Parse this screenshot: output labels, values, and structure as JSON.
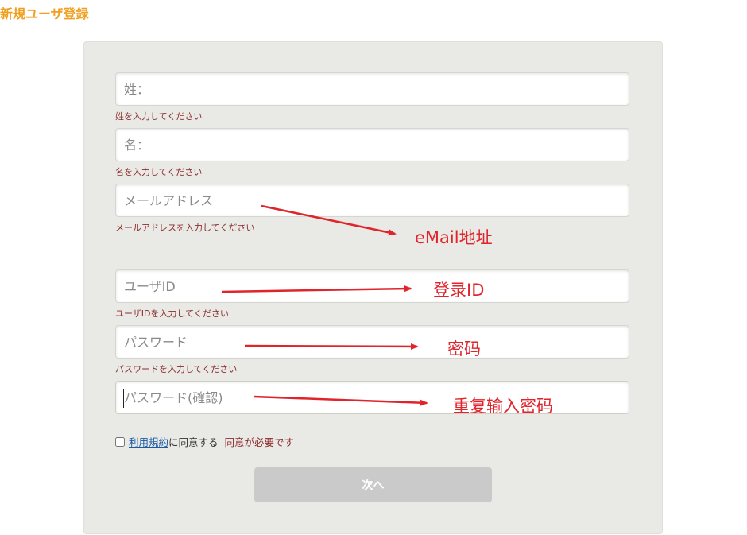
{
  "page": {
    "title": "新規ユーザ登録"
  },
  "form": {
    "last_name": {
      "placeholder": "姓：",
      "hint": "姓を入力してください"
    },
    "first_name": {
      "placeholder": "名：",
      "hint": "名を入力してください"
    },
    "email": {
      "placeholder": "メールアドレス",
      "hint": "メールアドレスを入力してください"
    },
    "user_id": {
      "placeholder": "ユーザID",
      "hint": "ユーザIDを入力してください"
    },
    "password": {
      "placeholder": "パスワード",
      "hint": "パスワードを入力してください"
    },
    "password_confirm": {
      "placeholder": "パスワード(確認)"
    },
    "agree": {
      "terms_link": "利用規約",
      "suffix": "に同意する",
      "error": "同意が必要です",
      "checked": false
    },
    "next_label": "次へ"
  },
  "annotations": {
    "email": "eMail地址",
    "user_id": "登录ID",
    "password": "密码",
    "password_confirm": "重复输入密码",
    "color": "#e0242b"
  },
  "colors": {
    "title": "#f0a020",
    "panel": "#e9e9e5",
    "error_text": "#8b2c2c",
    "link": "#1a5aa6",
    "button_disabled": "#cacaca"
  }
}
